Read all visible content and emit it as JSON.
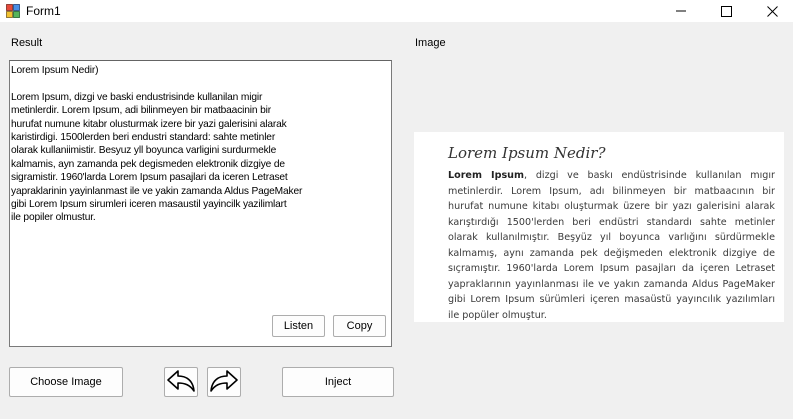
{
  "window": {
    "title": "Form1",
    "icons": {
      "app": "form-app-icon",
      "minimize": "minimize-icon",
      "maximize": "maximize-icon",
      "close": "close-icon"
    }
  },
  "left": {
    "label": "Result",
    "text": "Lorem Ipsum Nedir)\n\nLorem Ipsum, dizgi ve baski endustrisinde kullanilan migir\nmetinlerdir. Lorem Ipsum, adi bilinmeyen bir matbaacinin bir\nhurufat numune kitabr olusturmak izere bir yazi galerisini alarak\nkaristirdigi. 1500lerden beri endustri standard: sahte metinler\nolarak kullaniimistir. Besyuz yll boyunca varligini surdurmekle\nkalmamis, ayn zamanda pek degismeden elektronik dizgiye de\nsigramistir. 1960'larda Lorem Ipsum pasajlari da iceren Letraset\nyapraklarinin yayinlanmast ile ve yakin zamanda Aldus PageMaker\ngibi Lorem Ipsum sirumleri iceren masaustil yayincilk yazilimlart\nile popiler olmustur.",
    "listen_label": "Listen",
    "copy_label": "Copy"
  },
  "bottom": {
    "choose_label": "Choose Image",
    "undo_icon": "undo-arrow-icon",
    "redo_icon": "redo-arrow-icon",
    "inject_label": "Inject"
  },
  "right": {
    "label": "Image",
    "preview": {
      "title": "Lorem Ipsum Nedir?",
      "lead": "Lorem Ipsum",
      "body": ", dizgi ve baskı endüstrisinde kullanılan mıgır metinlerdir. Lorem Ipsum, adı bilinmeyen bir matbaacının bir hurufat numune kitabı oluşturmak üzere bir yazı galerisini alarak karıştırdığı 1500'lerden beri endüstri standardı sahte metinler olarak kullanılmıştır. Beşyüz yıl boyunca varlığını sürdürmekle kalmamış, aynı zamanda pek değişmeden elektronik dizgiye de sıçramıştır. 1960'larda Lorem Ipsum pasajları da içeren Letraset yapraklarının yayınlanması ile ve yakın zamanda Aldus PageMaker gibi Lorem Ipsum sürümleri içeren masaüstü yayıncılık yazılımları ile popüler olmuştur."
    }
  }
}
